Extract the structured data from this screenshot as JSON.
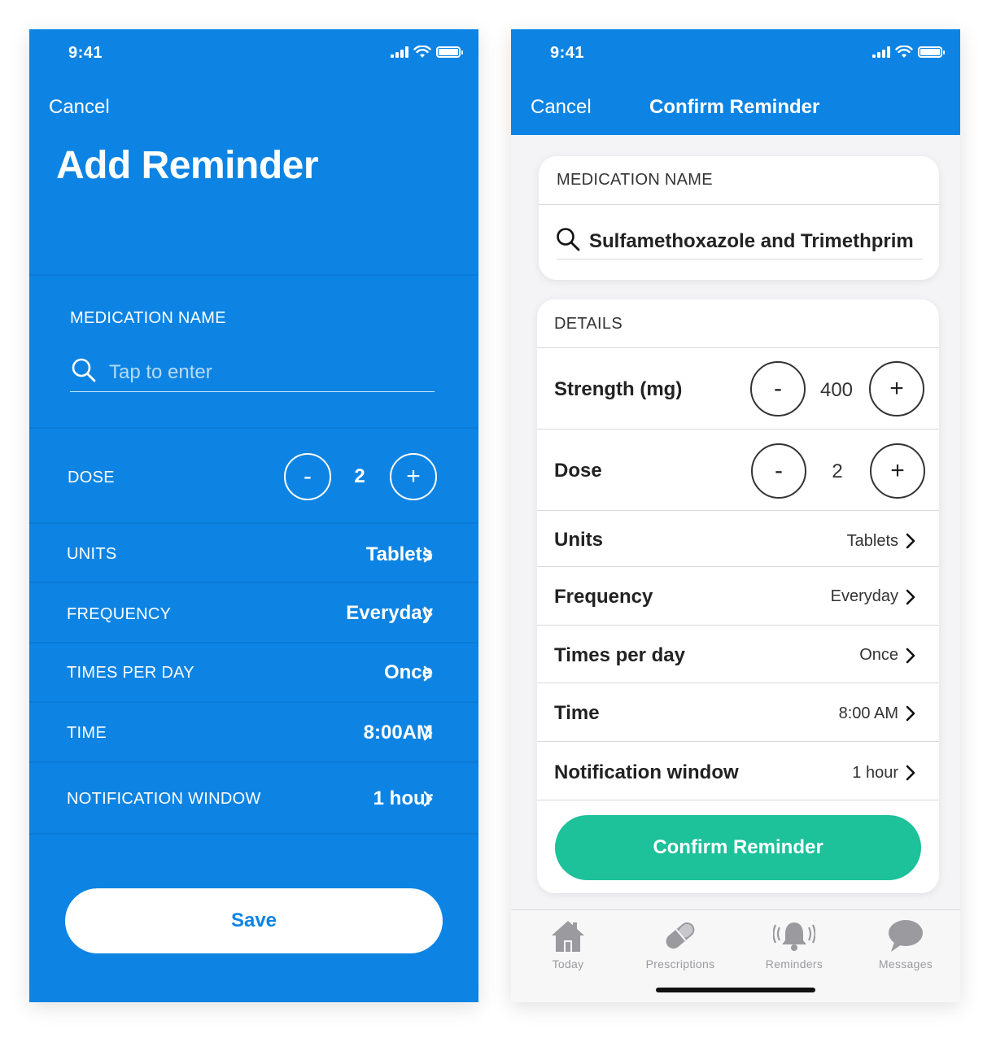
{
  "colors": {
    "primary_blue": "#0d84e3",
    "confirm_green": "#1dc19a",
    "tab_gray": "#9a9a9f"
  },
  "left": {
    "status_time": "9:41",
    "cancel": "Cancel",
    "title": "Add Reminder",
    "medication_label": "MEDICATION NAME",
    "search_placeholder": "Tap to enter",
    "dose_label": "DOSE",
    "dose_minus": "-",
    "dose_value": "2",
    "dose_plus": "+",
    "rows": [
      {
        "label": "UNITS",
        "value": "Tablets"
      },
      {
        "label": "FREQUENCY",
        "value": "Everyday"
      },
      {
        "label": "TIMES PER DAY",
        "value": "Once"
      },
      {
        "label": "TIME",
        "value": "8:00AM"
      },
      {
        "label": "NOTIFICATION WINDOW",
        "value": "1 hour"
      }
    ],
    "save": "Save"
  },
  "right": {
    "status_time": "9:41",
    "cancel": "Cancel",
    "title": "Confirm Reminder",
    "medication_label": "MEDICATION NAME",
    "medication_value": "Sulfamethoxazole and Trimethprim",
    "details_label": "DETAILS",
    "strength": {
      "label": "Strength (mg)",
      "minus": "-",
      "value": "400",
      "plus": "+"
    },
    "dose": {
      "label": "Dose",
      "minus": "-",
      "value": "2",
      "plus": "+"
    },
    "rows": [
      {
        "label": "Units",
        "value": "Tablets"
      },
      {
        "label": "Frequency",
        "value": "Everyday"
      },
      {
        "label": "Times per day",
        "value": "Once"
      },
      {
        "label": "Time",
        "value": "8:00 AM"
      },
      {
        "label": "Notification window",
        "value": "1 hour"
      }
    ],
    "confirm_button": "Confirm Reminder",
    "tabs": [
      {
        "label": "Today",
        "icon": "house-icon"
      },
      {
        "label": "Prescriptions",
        "icon": "pill-icon"
      },
      {
        "label": "Reminders",
        "icon": "bell-icon"
      },
      {
        "label": "Messages",
        "icon": "chat-bubble-icon"
      }
    ]
  }
}
